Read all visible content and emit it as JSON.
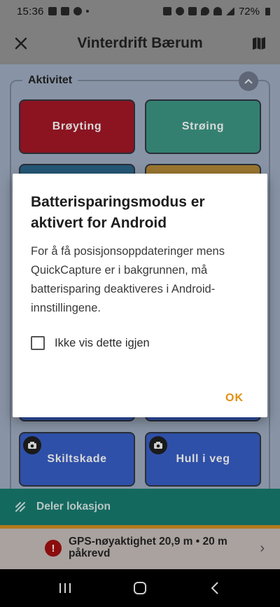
{
  "status_bar": {
    "time": "15:36",
    "battery": "72%"
  },
  "header": {
    "title": "Vinterdrift Bærum"
  },
  "group": {
    "label": "Aktivitet"
  },
  "tiles": [
    {
      "label": "Brøyting",
      "color": "#8b1420"
    },
    {
      "label": "Strøing",
      "color": "#338071"
    },
    {
      "label": "",
      "color": "#255776"
    },
    {
      "label": "",
      "color": "#9a7630"
    },
    {
      "label": "Skiltskade",
      "color": "#2f50a8"
    },
    {
      "label": "Hull i veg",
      "color": "#2f50a8"
    }
  ],
  "dialog": {
    "title": "Batterisparingsmodus er aktivert for Android",
    "body": "For å få posisjonsoppdateringer mens QuickCapture er i bakgrunnen, må batterisparing deaktiveres i Android-innstillingene.",
    "checkbox_label": "Ikke vis dette igjen",
    "checkbox_checked": false,
    "ok_label": "OK",
    "accent_color": "#e08f10"
  },
  "share_bar": {
    "label": "Deler lokasjon"
  },
  "gps_bar": {
    "text": "GPS-nøyaktighet 20,9 m • 20 m påkrevd"
  },
  "icons": {
    "close": "close-icon",
    "map": "map-icon",
    "collapse": "chevron-up-icon",
    "camera": "camera-icon",
    "share": "share-location-icon",
    "error": "error-icon",
    "chevron": "chevron-right-icon"
  }
}
